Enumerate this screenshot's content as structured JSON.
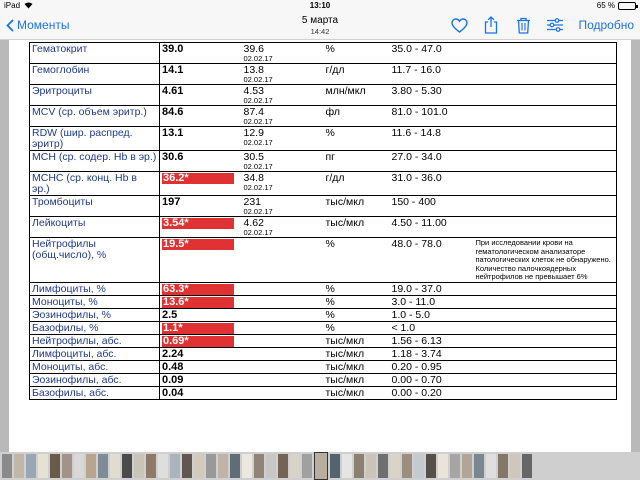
{
  "status": {
    "device": "iPad",
    "wifi": "wifi-icon",
    "time": "13:10",
    "battery": "65 %",
    "battery_level": 0.65
  },
  "nav": {
    "back_label": "Моменты",
    "date": "5 марта",
    "time": "14:42",
    "detail_label": "Подробно",
    "icons": [
      "heart-icon",
      "share-icon",
      "trash-icon",
      "sliders-icon"
    ]
  },
  "rows": [
    {
      "name": "Гематокрит",
      "value": "39.0",
      "flag": false,
      "prev_value": "39.6",
      "prev_date": "02.02.17",
      "unit": "%",
      "ref": "35.0 - 47.0",
      "note": ""
    },
    {
      "name": "Гемоглобин",
      "value": "14.1",
      "flag": false,
      "prev_value": "13.8",
      "prev_date": "02.02.17",
      "unit": "г/дл",
      "ref": "11.7 - 16.0",
      "note": ""
    },
    {
      "name": "Эритроциты",
      "value": "4.61",
      "flag": false,
      "prev_value": "4.53",
      "prev_date": "02.02.17",
      "unit": "млн/мкл",
      "ref": "3.80 - 5.30",
      "note": ""
    },
    {
      "name": "MCV (ср. объем эритр.)",
      "value": "84.6",
      "flag": false,
      "prev_value": "87.4",
      "prev_date": "02.02.17",
      "unit": "фл",
      "ref": "81.0 - 101.0",
      "note": ""
    },
    {
      "name": "RDW (шир. распред. эритр)",
      "value": "13.1",
      "flag": false,
      "prev_value": "12.9",
      "prev_date": "02.02.17",
      "unit": "%",
      "ref": "11.6 - 14.8",
      "note": ""
    },
    {
      "name": "MCH (ср. содер. Hb в эр.)",
      "value": "30.6",
      "flag": false,
      "prev_value": "30.5",
      "prev_date": "02.02.17",
      "unit": "пг",
      "ref": "27.0 - 34.0",
      "note": ""
    },
    {
      "name": "MCHC (ср. конц. Hb в эр.)",
      "value": "36.2*",
      "flag": true,
      "prev_value": "34.8",
      "prev_date": "02.02.17",
      "unit": "г/дл",
      "ref": "31.0 - 36.0",
      "note": ""
    },
    {
      "name": "Тромбоциты",
      "value": "197",
      "flag": false,
      "prev_value": "231",
      "prev_date": "02.02.17",
      "unit": "тыс/мкл",
      "ref": "150 - 400",
      "note": ""
    },
    {
      "name": "Лейкоциты",
      "value": "3.54*",
      "flag": true,
      "prev_value": "4.62",
      "prev_date": "02.02.17",
      "unit": "тыс/мкл",
      "ref": "4.50 - 11.00",
      "note": ""
    },
    {
      "name": "Нейтрофилы (общ.число), %",
      "value": "19.5*",
      "flag": true,
      "prev_value": "",
      "prev_date": "",
      "unit": "%",
      "ref": "48.0 - 78.0",
      "note": "При исследовании крови на гематологическом анализаторе патологических клеток не обнаружено. Количество палочкоядерных нейтрофилов не превышает 6%"
    },
    {
      "name": "Лимфоциты, %",
      "value": "63.3*",
      "flag": true,
      "prev_value": "",
      "prev_date": "",
      "unit": "%",
      "ref": "19.0 - 37.0",
      "note": ""
    },
    {
      "name": "Моноциты, %",
      "value": "13.6*",
      "flag": true,
      "prev_value": "",
      "prev_date": "",
      "unit": "%",
      "ref": "3.0 - 11.0",
      "note": ""
    },
    {
      "name": "Эозинофилы, %",
      "value": "2.5",
      "flag": false,
      "prev_value": "",
      "prev_date": "",
      "unit": "%",
      "ref": "1.0 - 5.0",
      "note": ""
    },
    {
      "name": "Базофилы, %",
      "value": "1.1*",
      "flag": true,
      "prev_value": "",
      "prev_date": "",
      "unit": "%",
      "ref": "< 1.0",
      "note": ""
    },
    {
      "name": "Нейтрофилы, абс.",
      "value": "0.69*",
      "flag": true,
      "prev_value": "",
      "prev_date": "",
      "unit": "тыс/мкл",
      "ref": "1.56 - 6.13",
      "note": ""
    },
    {
      "name": "Лимфоциты, абс.",
      "value": "2.24",
      "flag": false,
      "prev_value": "",
      "prev_date": "",
      "unit": "тыс/мкл",
      "ref": "1.18 - 3.74",
      "note": ""
    },
    {
      "name": "Моноциты, абс.",
      "value": "0.48",
      "flag": false,
      "prev_value": "",
      "prev_date": "",
      "unit": "тыс/мкл",
      "ref": "0.20 - 0.95",
      "note": ""
    },
    {
      "name": "Эозинофилы, абс.",
      "value": "0.09",
      "flag": false,
      "prev_value": "",
      "prev_date": "",
      "unit": "тыс/мкл",
      "ref": "0.00 - 0.70",
      "note": ""
    },
    {
      "name": "Базофилы, абс.",
      "value": "0.04",
      "flag": false,
      "prev_value": "",
      "prev_date": "",
      "unit": "тыс/мкл",
      "ref": "0.00 - 0.20",
      "note": ""
    }
  ],
  "colors": {
    "accent": "#1a73e8",
    "flag": "#e03232",
    "name_text": "#1f3a8c"
  },
  "thumbnails": [
    "#8a8a8a",
    "#c0b7a8",
    "#9aa6b3",
    "#e6e1d5",
    "#6a5a4a",
    "#a3928a",
    "#d8d8d8",
    "#b7a590",
    "#7d8c95",
    "#e0dcd0",
    "#4a4a4a",
    "#c9c4b8",
    "#8e7a66",
    "#dedede",
    "#a9b4bc",
    "#615650",
    "#d2cabb",
    "#999999",
    "#bfb4a6",
    "#5e6d78",
    "#ece8e0",
    "#8f8475",
    "#c7c7c7",
    "#746456",
    "#d9d3c7",
    "#a0a0a0",
    "#b8aea0",
    "#556270",
    "#e5e5e5",
    "#8b7f72",
    "#cbc3b5",
    "#6f6f6f",
    "#dad4c8",
    "#9c8d7e",
    "#c4cbd0",
    "#575049",
    "#e8e4da",
    "#a5a5a5",
    "#b2a596",
    "#7a8790",
    "#dfdfdf",
    "#847668",
    "#cfc8ba",
    "#666666"
  ]
}
